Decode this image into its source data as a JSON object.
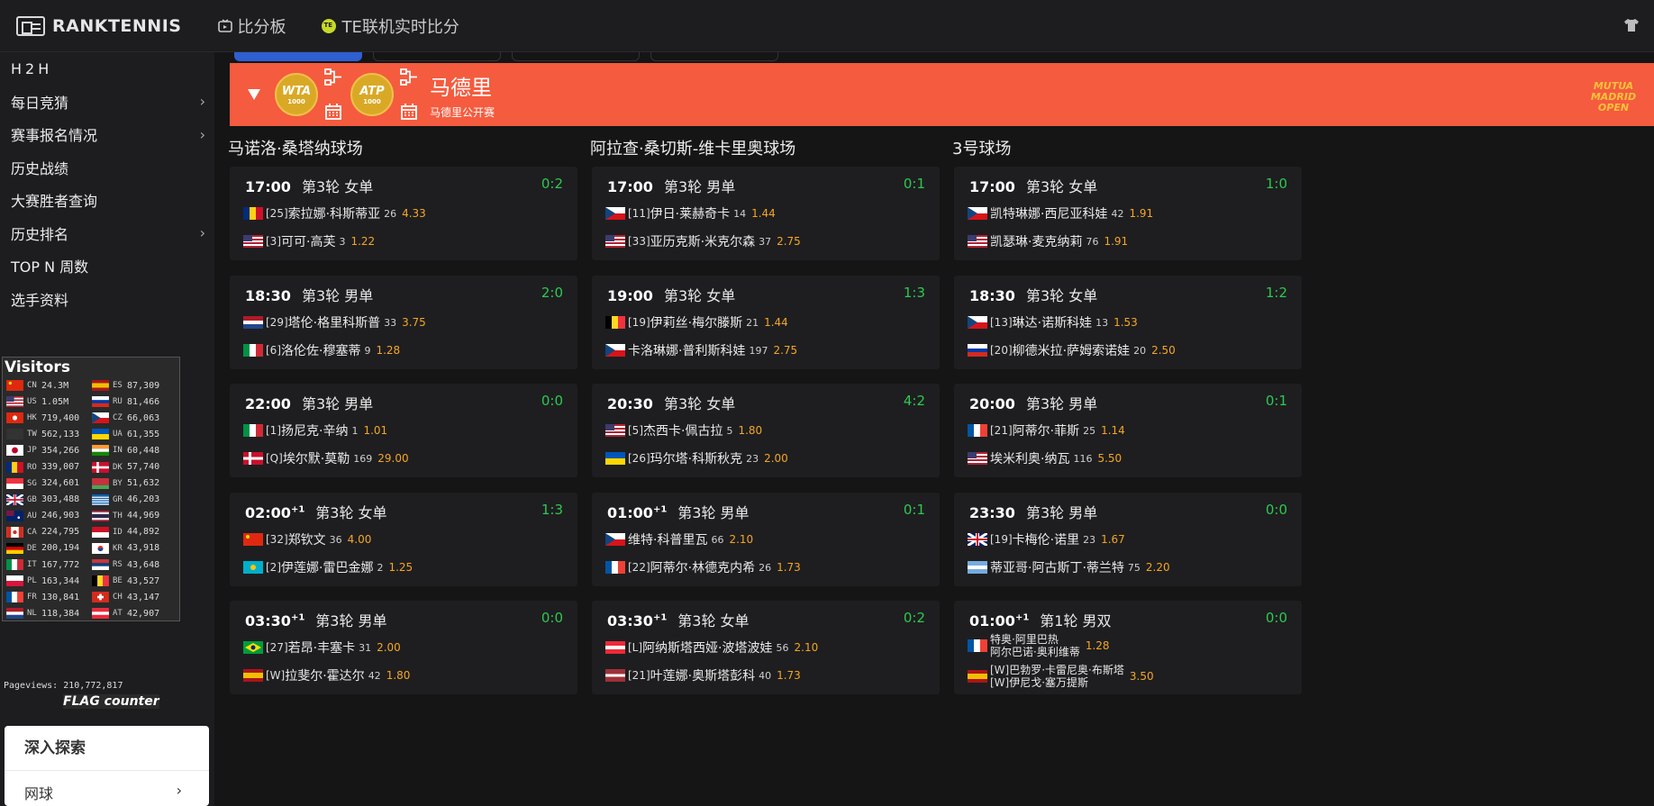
{
  "header": {
    "logo_text": "RANKTENNIS",
    "nav": [
      {
        "label": "比分板",
        "icon": "scoreboard-icon"
      },
      {
        "label": "TE联机实时比分",
        "icon": "tennis-ball-icon"
      }
    ],
    "right_icon": "shirt-icon"
  },
  "sidebar": {
    "items": [
      {
        "label": "H2H",
        "chevron": false
      },
      {
        "label": "每日竞猜",
        "chevron": true
      },
      {
        "label": "赛事报名情况",
        "chevron": true
      },
      {
        "label": "历史战绩",
        "chevron": false
      },
      {
        "label": "大赛胜者查询",
        "chevron": false
      },
      {
        "label": "历史排名",
        "chevron": true
      },
      {
        "label": "TOP N 周数",
        "chevron": false
      },
      {
        "label": "选手资料",
        "chevron": false
      }
    ],
    "chevron_glyph": "›"
  },
  "visitors": {
    "title": "Visitors",
    "rows": [
      [
        {
          "code": "CN",
          "count": "24.3M",
          "flag": "cn"
        },
        {
          "code": "ES",
          "count": "87,309",
          "flag": "es"
        }
      ],
      [
        {
          "code": "US",
          "count": "1.05M",
          "flag": "us"
        },
        {
          "code": "RU",
          "count": "81,466",
          "flag": "ru"
        }
      ],
      [
        {
          "code": "HK",
          "count": "719,400",
          "flag": "hk"
        },
        {
          "code": "CZ",
          "count": "66,063",
          "flag": "cz"
        }
      ],
      [
        {
          "code": "TW",
          "count": "562,133",
          "flag": "tw"
        },
        {
          "code": "UA",
          "count": "61,355",
          "flag": "ua"
        }
      ],
      [
        {
          "code": "JP",
          "count": "354,266",
          "flag": "jp"
        },
        {
          "code": "IN",
          "count": "60,448",
          "flag": "in"
        }
      ],
      [
        {
          "code": "RO",
          "count": "339,007",
          "flag": "ro"
        },
        {
          "code": "DK",
          "count": "57,740",
          "flag": "dk"
        }
      ],
      [
        {
          "code": "SG",
          "count": "324,601",
          "flag": "sg"
        },
        {
          "code": "BY",
          "count": "51,632",
          "flag": "by"
        }
      ],
      [
        {
          "code": "GB",
          "count": "303,488",
          "flag": "gb"
        },
        {
          "code": "GR",
          "count": "46,203",
          "flag": "gr"
        }
      ],
      [
        {
          "code": "AU",
          "count": "246,903",
          "flag": "au"
        },
        {
          "code": "TH",
          "count": "44,969",
          "flag": "th"
        }
      ],
      [
        {
          "code": "CA",
          "count": "224,795",
          "flag": "ca"
        },
        {
          "code": "ID",
          "count": "44,892",
          "flag": "id"
        }
      ],
      [
        {
          "code": "DE",
          "count": "200,194",
          "flag": "de"
        },
        {
          "code": "KR",
          "count": "43,918",
          "flag": "kr"
        }
      ],
      [
        {
          "code": "IT",
          "count": "167,772",
          "flag": "it"
        },
        {
          "code": "RS",
          "count": "43,648",
          "flag": "rs"
        }
      ],
      [
        {
          "code": "PL",
          "count": "163,344",
          "flag": "pl"
        },
        {
          "code": "BE",
          "count": "43,527",
          "flag": "be"
        }
      ],
      [
        {
          "code": "FR",
          "count": "130,841",
          "flag": "fr"
        },
        {
          "code": "CH",
          "count": "43,147",
          "flag": "ch"
        }
      ],
      [
        {
          "code": "NL",
          "count": "118,384",
          "flag": "nl"
        },
        {
          "code": "AT",
          "count": "42,907",
          "flag": "at"
        }
      ]
    ],
    "pageviews_label": "Pageviews:",
    "pageviews": "210,772,817",
    "badge": "FLAG counter"
  },
  "explore": {
    "title": "深入探索",
    "item": "网球",
    "chevron": "›"
  },
  "tournament": {
    "name": "马德里",
    "subtitle": "马德里公开赛",
    "badge_wta": "WTA",
    "badge_wta_sub": "1000",
    "badge_atp": "ATP",
    "badge_atp_sub": "1000",
    "logo_text": "MUTUA MADRID OPEN"
  },
  "courts": [
    {
      "name": "马诺洛·桑塔纳球场",
      "matches": [
        {
          "time": "17:00",
          "plus": "",
          "round": "第3轮 女单",
          "score": "0:2",
          "p1": {
            "flag": "ro",
            "seed": "[25]",
            "name": "索拉娜·科斯蒂亚",
            "rank": "26",
            "odds": "4.33"
          },
          "p2": {
            "flag": "us",
            "seed": "[3]",
            "name": "可可·高芙",
            "rank": "3",
            "odds": "1.22"
          }
        },
        {
          "time": "18:30",
          "plus": "",
          "round": "第3轮 男单",
          "score": "2:0",
          "p1": {
            "flag": "nl",
            "seed": "[29]",
            "name": "塔伦·格里科斯普",
            "rank": "33",
            "odds": "3.75"
          },
          "p2": {
            "flag": "it",
            "seed": "[6]",
            "name": "洛伦佐·穆塞蒂",
            "rank": "9",
            "odds": "1.28"
          }
        },
        {
          "time": "22:00",
          "plus": "",
          "round": "第3轮 男单",
          "score": "0:0",
          "p1": {
            "flag": "it",
            "seed": "[1]",
            "name": "扬尼克·辛纳",
            "rank": "1",
            "odds": "1.01"
          },
          "p2": {
            "flag": "dk",
            "seed": "[Q]",
            "name": "埃尔默·莫勒",
            "rank": "169",
            "odds": "29.00"
          }
        },
        {
          "time": "02:00",
          "plus": "+1",
          "round": "第3轮 女单",
          "score": "1:3",
          "p1": {
            "flag": "cn",
            "seed": "[32]",
            "name": "郑钦文",
            "rank": "36",
            "odds": "4.00"
          },
          "p2": {
            "flag": "kz",
            "seed": "[2]",
            "name": "伊莲娜·雷巴金娜",
            "rank": "2",
            "odds": "1.25"
          }
        },
        {
          "time": "03:30",
          "plus": "+1",
          "round": "第3轮 男单",
          "score": "0:0",
          "p1": {
            "flag": "br",
            "seed": "[27]",
            "name": "若昂·丰塞卡",
            "rank": "31",
            "odds": "2.00"
          },
          "p2": {
            "flag": "es",
            "seed": "[W]",
            "name": "拉斐尔·霍达尔",
            "rank": "42",
            "odds": "1.80"
          }
        }
      ]
    },
    {
      "name": "阿拉查·桑切斯-维卡里奥球场",
      "matches": [
        {
          "time": "17:00",
          "plus": "",
          "round": "第3轮 男单",
          "score": "0:1",
          "p1": {
            "flag": "cz",
            "seed": "[11]",
            "name": "伊日·莱赫奇卡",
            "rank": "14",
            "odds": "1.44"
          },
          "p2": {
            "flag": "us",
            "seed": "[33]",
            "name": "亚历克斯·米克尔森",
            "rank": "37",
            "odds": "2.75"
          }
        },
        {
          "time": "19:00",
          "plus": "",
          "round": "第3轮 女单",
          "score": "1:3",
          "p1": {
            "flag": "be",
            "seed": "[19]",
            "name": "伊莉丝·梅尔滕斯",
            "rank": "21",
            "odds": "1.44"
          },
          "p2": {
            "flag": "cz",
            "seed": "",
            "name": "卡洛琳娜·普利斯科娃",
            "rank": "197",
            "odds": "2.75"
          }
        },
        {
          "time": "20:30",
          "plus": "",
          "round": "第3轮 女单",
          "score": "4:2",
          "p1": {
            "flag": "us",
            "seed": "[5]",
            "name": "杰西卡·佩古拉",
            "rank": "5",
            "odds": "1.80"
          },
          "p2": {
            "flag": "ua",
            "seed": "[26]",
            "name": "玛尔塔·科斯秋克",
            "rank": "23",
            "odds": "2.00"
          }
        },
        {
          "time": "01:00",
          "plus": "+1",
          "round": "第3轮 男单",
          "score": "0:1",
          "p1": {
            "flag": "cz",
            "seed": "",
            "name": "维特·科普里瓦",
            "rank": "66",
            "odds": "2.10"
          },
          "p2": {
            "flag": "fr",
            "seed": "[22]",
            "name": "阿蒂尔·林德克内希",
            "rank": "26",
            "odds": "1.73"
          }
        },
        {
          "time": "03:30",
          "plus": "+1",
          "round": "第3轮 女单",
          "score": "0:2",
          "p1": {
            "flag": "at",
            "seed": "[L]",
            "name": "阿纳斯塔西娅·波塔波娃",
            "rank": "56",
            "odds": "2.10"
          },
          "p2": {
            "flag": "lv",
            "seed": "[21]",
            "name": "叶莲娜·奥斯塔彭科",
            "rank": "40",
            "odds": "1.73"
          }
        }
      ]
    },
    {
      "name": "3号球场",
      "matches": [
        {
          "time": "17:00",
          "plus": "",
          "round": "第3轮 女单",
          "score": "1:0",
          "p1": {
            "flag": "cz",
            "seed": "",
            "name": "凯特琳娜·西尼亚科娃",
            "rank": "42",
            "odds": "1.91"
          },
          "p2": {
            "flag": "us",
            "seed": "",
            "name": "凯瑟琳·麦克纳莉",
            "rank": "76",
            "odds": "1.91"
          }
        },
        {
          "time": "18:30",
          "plus": "",
          "round": "第3轮 女单",
          "score": "1:2",
          "p1": {
            "flag": "cz",
            "seed": "[13]",
            "name": "琳达·诺斯科娃",
            "rank": "13",
            "odds": "1.53"
          },
          "p2": {
            "flag": "ru",
            "seed": "[20]",
            "name": "柳德米拉·萨姆索诺娃",
            "rank": "20",
            "odds": "2.50"
          }
        },
        {
          "time": "20:00",
          "plus": "",
          "round": "第3轮 男单",
          "score": "0:1",
          "p1": {
            "flag": "fr",
            "seed": "[21]",
            "name": "阿蒂尔·菲斯",
            "rank": "25",
            "odds": "1.14"
          },
          "p2": {
            "flag": "us",
            "seed": "",
            "name": "埃米利奥·纳瓦",
            "rank": "116",
            "odds": "5.50"
          }
        },
        {
          "time": "23:30",
          "plus": "",
          "round": "第3轮 男单",
          "score": "0:0",
          "p1": {
            "flag": "gb",
            "seed": "[19]",
            "name": "卡梅伦·诺里",
            "rank": "23",
            "odds": "1.67"
          },
          "p2": {
            "flag": "ar",
            "seed": "",
            "name": "蒂亚哥·阿古斯丁·蒂兰特",
            "rank": "75",
            "odds": "2.20"
          }
        },
        {
          "time": "01:00",
          "plus": "+1",
          "round": "第1轮 男双",
          "score": "0:0",
          "doubles": true,
          "p1": {
            "flag": "fr",
            "seed": "",
            "name": "特奥·阿里巴热",
            "name2": "阿尔巴诺·奥利维蒂",
            "rank": "",
            "odds": "1.28"
          },
          "p2": {
            "flag": "es",
            "seed": "[W]",
            "name": "巴勃罗·卡雷尼奥·布斯塔",
            "seed2": "[W]",
            "name2": "伊尼戈·塞万提斯",
            "rank": "",
            "odds": "3.50"
          }
        }
      ]
    }
  ]
}
